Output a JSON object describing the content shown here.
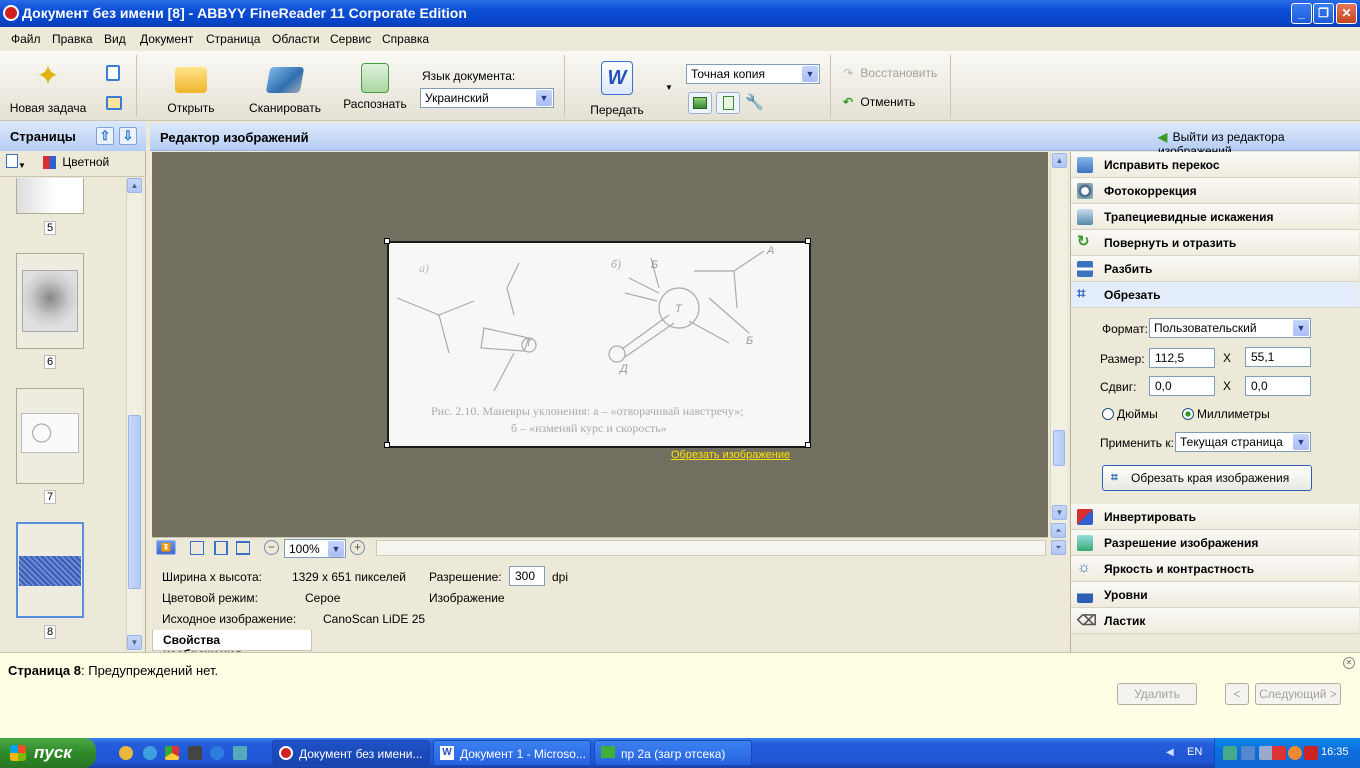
{
  "window": {
    "title": "Документ без имени [8] - ABBYY FineReader 11 Corporate Edition"
  },
  "menu": [
    "Файл",
    "Правка",
    "Вид",
    "Документ",
    "Страница",
    "Области",
    "Сервис",
    "Справка"
  ],
  "toolbar": {
    "new_task": "Новая задача",
    "open": "Открыть",
    "scan": "Сканировать",
    "recognize": "Распознать",
    "doc_language_label": "Язык документа:",
    "doc_language_value": "Украинский",
    "send": "Передать",
    "format_value": "Точная копия",
    "restore": "Восстановить",
    "cancel": "Отменить"
  },
  "pages_panel": {
    "title": "Страницы",
    "color_mode": "Цветной",
    "pages": [
      "5",
      "6",
      "7",
      "8"
    ],
    "selected": "8"
  },
  "editor": {
    "title": "Редактор изображений",
    "exit": "Выйти из редактора изображений",
    "crop_link": "Обрезать изображение",
    "figure_caption_1": "Рис. 2.10. Маневры уклонения: а – «отворачивай навстречу»;",
    "figure_caption_2": "б – «изменяй курс и скорость»",
    "figure_labels": [
      "а)",
      "б)",
      "Б",
      "А",
      "Б",
      "Т",
      "Т",
      "Д"
    ],
    "zoom": "100%"
  },
  "image_info": {
    "size_label": "Ширина х высота:",
    "size_value": "1329 x 651 пикселей",
    "resolution_label": "Разрешение:",
    "resolution_value": "300",
    "resolution_unit": "dpi",
    "color_label": "Цветовой режим:",
    "color_value": "Серое",
    "type_value": "Изображение",
    "source_label": "Исходное изображение:",
    "source_value": "CanoScan LiDE 25",
    "tab": "Свойства изображения"
  },
  "right_panel": {
    "items_top": [
      "Исправить перекос",
      "Фотокоррекция",
      "Трапециевидные искажения",
      "Повернуть и отразить",
      "Разбить",
      "Обрезать"
    ],
    "crop": {
      "format_label": "Формат:",
      "format_value": "Пользовательский",
      "size_label": "Размер:",
      "width": "112,5",
      "height": "55,1",
      "x_sep": "X",
      "shift_label": "Сдвиг:",
      "shift_x": "0,0",
      "shift_y": "0,0",
      "unit_inches": "Дюймы",
      "unit_mm": "Миллиметры",
      "unit_selected": "Миллиметры",
      "apply_label": "Применить к:",
      "apply_value": "Текущая страница",
      "crop_button": "Обрезать края изображения"
    },
    "items_bottom": [
      "Инвертировать",
      "Разрешение изображения",
      "Яркость и контрастность",
      "Уровни",
      "Ластик"
    ]
  },
  "status": {
    "page_label": "Страница 8",
    "message": ": Предупреждений нет.",
    "delete": "Удалить",
    "prev": "<",
    "next": "Следующий >"
  },
  "taskbar": {
    "start": "пуск",
    "tasks": [
      "Документ без имени...",
      "Документ 1 - Microso...",
      "пр 2а (загр отсека)"
    ],
    "lang": "EN",
    "time": "16:35"
  },
  "colors": {
    "accent": "#2055D3",
    "header": "#B5CDF4",
    "canvas": "#726F60",
    "link": "#FFE600"
  }
}
